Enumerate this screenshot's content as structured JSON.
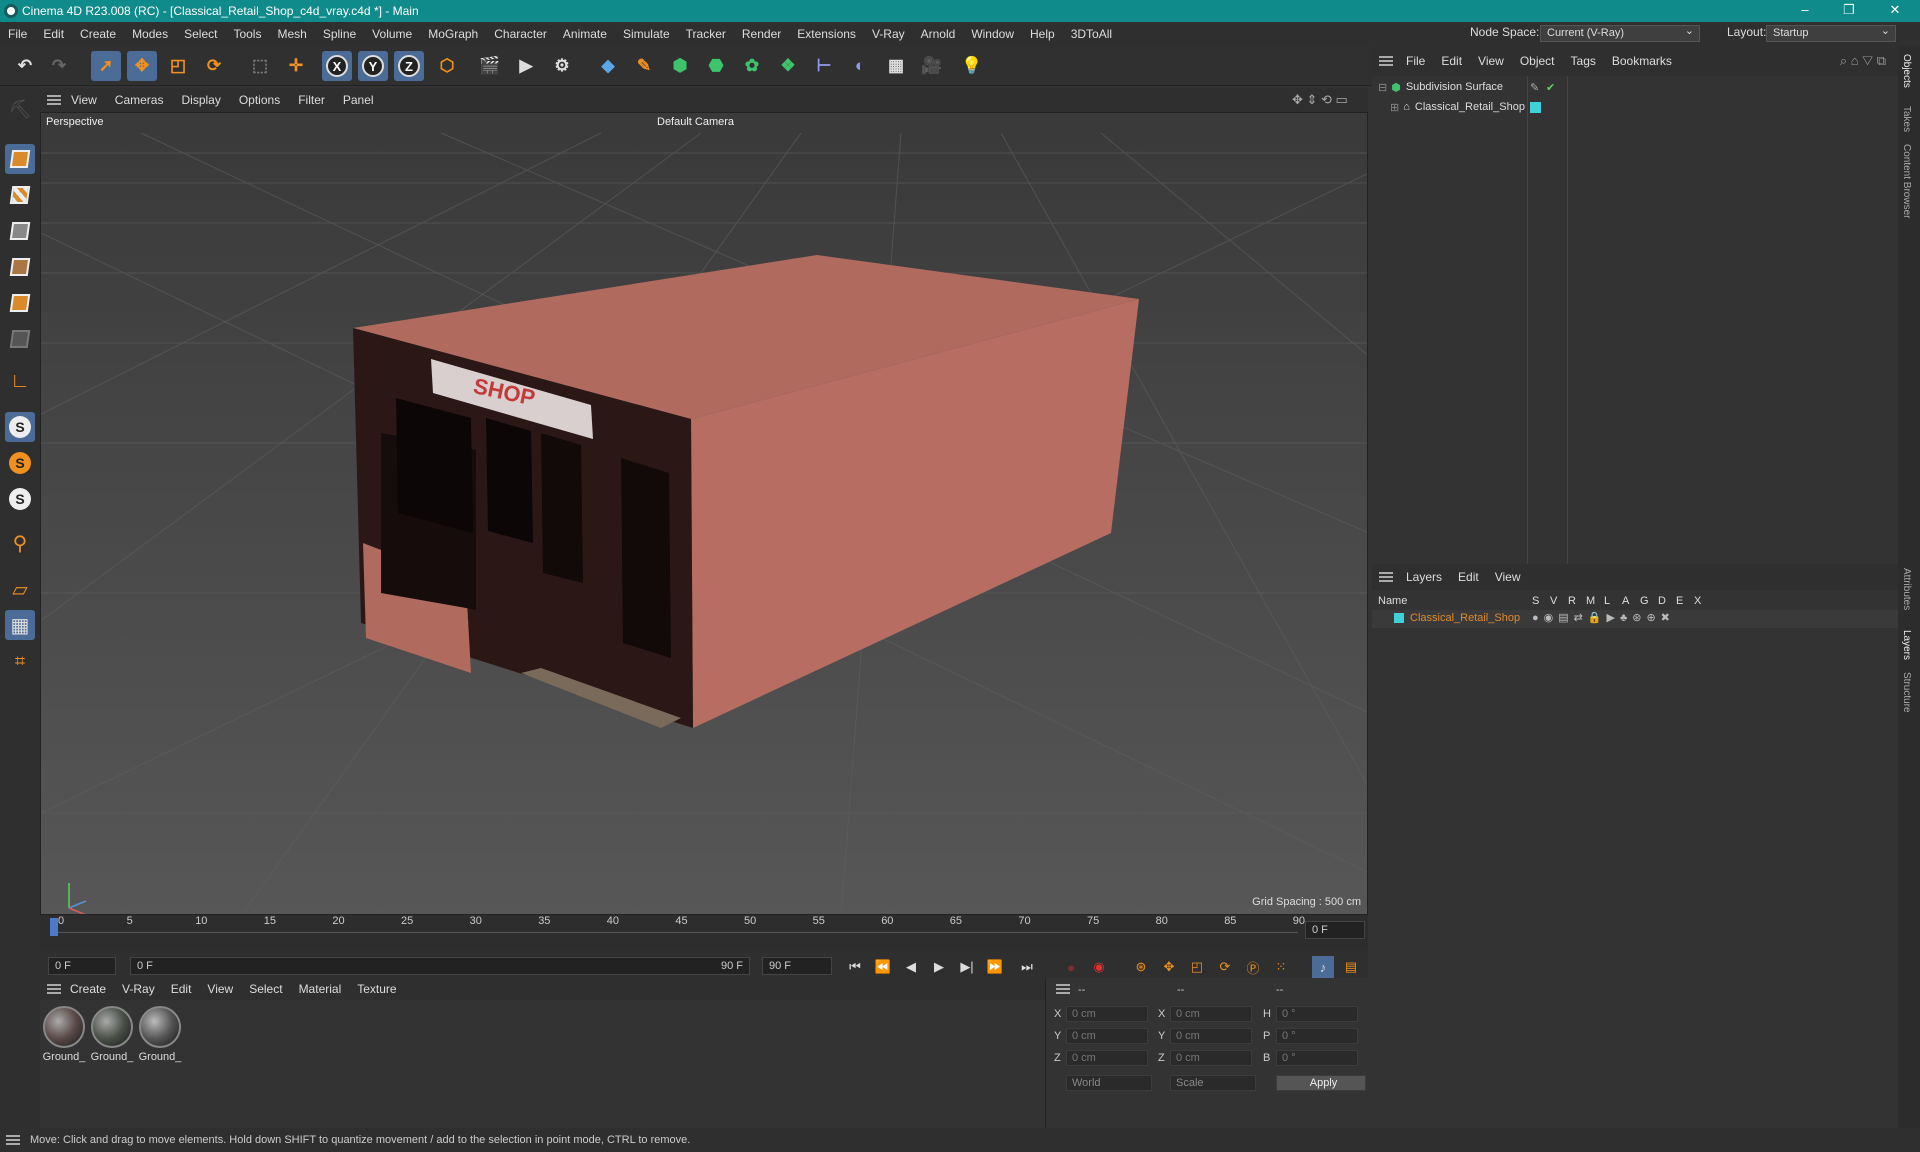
{
  "window": {
    "title": "Cinema 4D R23.008 (RC) - [Classical_Retail_Shop_c4d_vray.c4d *] - Main"
  },
  "menu": [
    "File",
    "Edit",
    "Create",
    "Modes",
    "Select",
    "Tools",
    "Mesh",
    "Spline",
    "Volume",
    "MoGraph",
    "Character",
    "Animate",
    "Simulate",
    "Tracker",
    "Render",
    "Extensions",
    "V-Ray",
    "Arnold",
    "Window",
    "Help",
    "3DToAll"
  ],
  "node_space": {
    "label": "Node Space:",
    "value": "Current (V-Ray)"
  },
  "layout": {
    "label": "Layout:",
    "value": "Startup"
  },
  "toolbar": {
    "axis_x": "X",
    "axis_y": "Y",
    "axis_z": "Z"
  },
  "viewport_menu": [
    "View",
    "Cameras",
    "Display",
    "Options",
    "Filter",
    "Panel"
  ],
  "viewport": {
    "name": "Perspective",
    "camera": "Default Camera",
    "grid_spacing": "Grid Spacing : 500 cm",
    "sign": "SHOP"
  },
  "timeline": {
    "ticks": [
      "0",
      "5",
      "10",
      "15",
      "20",
      "25",
      "30",
      "35",
      "40",
      "45",
      "50",
      "55",
      "60",
      "65",
      "70",
      "75",
      "80",
      "85",
      "90"
    ],
    "frame_right": "0 F"
  },
  "playback": {
    "start": "0 F",
    "range_start": "0 F",
    "range_end": "90 F",
    "end": "90 F"
  },
  "material_menu": [
    "Create",
    "V-Ray",
    "Edit",
    "View",
    "Select",
    "Material",
    "Texture"
  ],
  "materials": [
    "Ground_",
    "Ground_",
    "Ground_"
  ],
  "coords": {
    "header": [
      "--",
      "--",
      "--"
    ],
    "row_labels": [
      "X",
      "Y",
      "Z"
    ],
    "mid_labels": [
      "X",
      "Y",
      "Z"
    ],
    "rot_labels": [
      "H",
      "P",
      "B"
    ],
    "pos": [
      "0 cm",
      "0 cm",
      "0 cm"
    ],
    "size": [
      "0 cm",
      "0 cm",
      "0 cm"
    ],
    "rot": [
      "0 °",
      "0 °",
      "0 °"
    ],
    "world": "World",
    "scale": "Scale",
    "apply": "Apply"
  },
  "status": "Move: Click and drag to move elements. Hold down SHIFT to quantize movement / add to the selection in point mode, CTRL to remove.",
  "object_menu": [
    "File",
    "Edit",
    "View",
    "Object",
    "Tags",
    "Bookmarks"
  ],
  "objects": [
    "Subdivision Surface",
    "Classical_Retail_Shop"
  ],
  "layers_menu": [
    "Layers",
    "Edit",
    "View"
  ],
  "layers_header": {
    "name": "Name",
    "cols": [
      "S",
      "V",
      "R",
      "M",
      "L",
      "A",
      "G",
      "D",
      "E",
      "X"
    ]
  },
  "layers": [
    "Classical_Retail_Shop"
  ],
  "side_tabs": [
    "Objects",
    "Takes",
    "Content Browser",
    "Attributes",
    "Layers",
    "Structure"
  ],
  "colors": {
    "titlebar": "#108b8b",
    "accent": "#4a6c96",
    "layer_name": "#e08a2c",
    "layer_color": "#3fd0d8"
  }
}
